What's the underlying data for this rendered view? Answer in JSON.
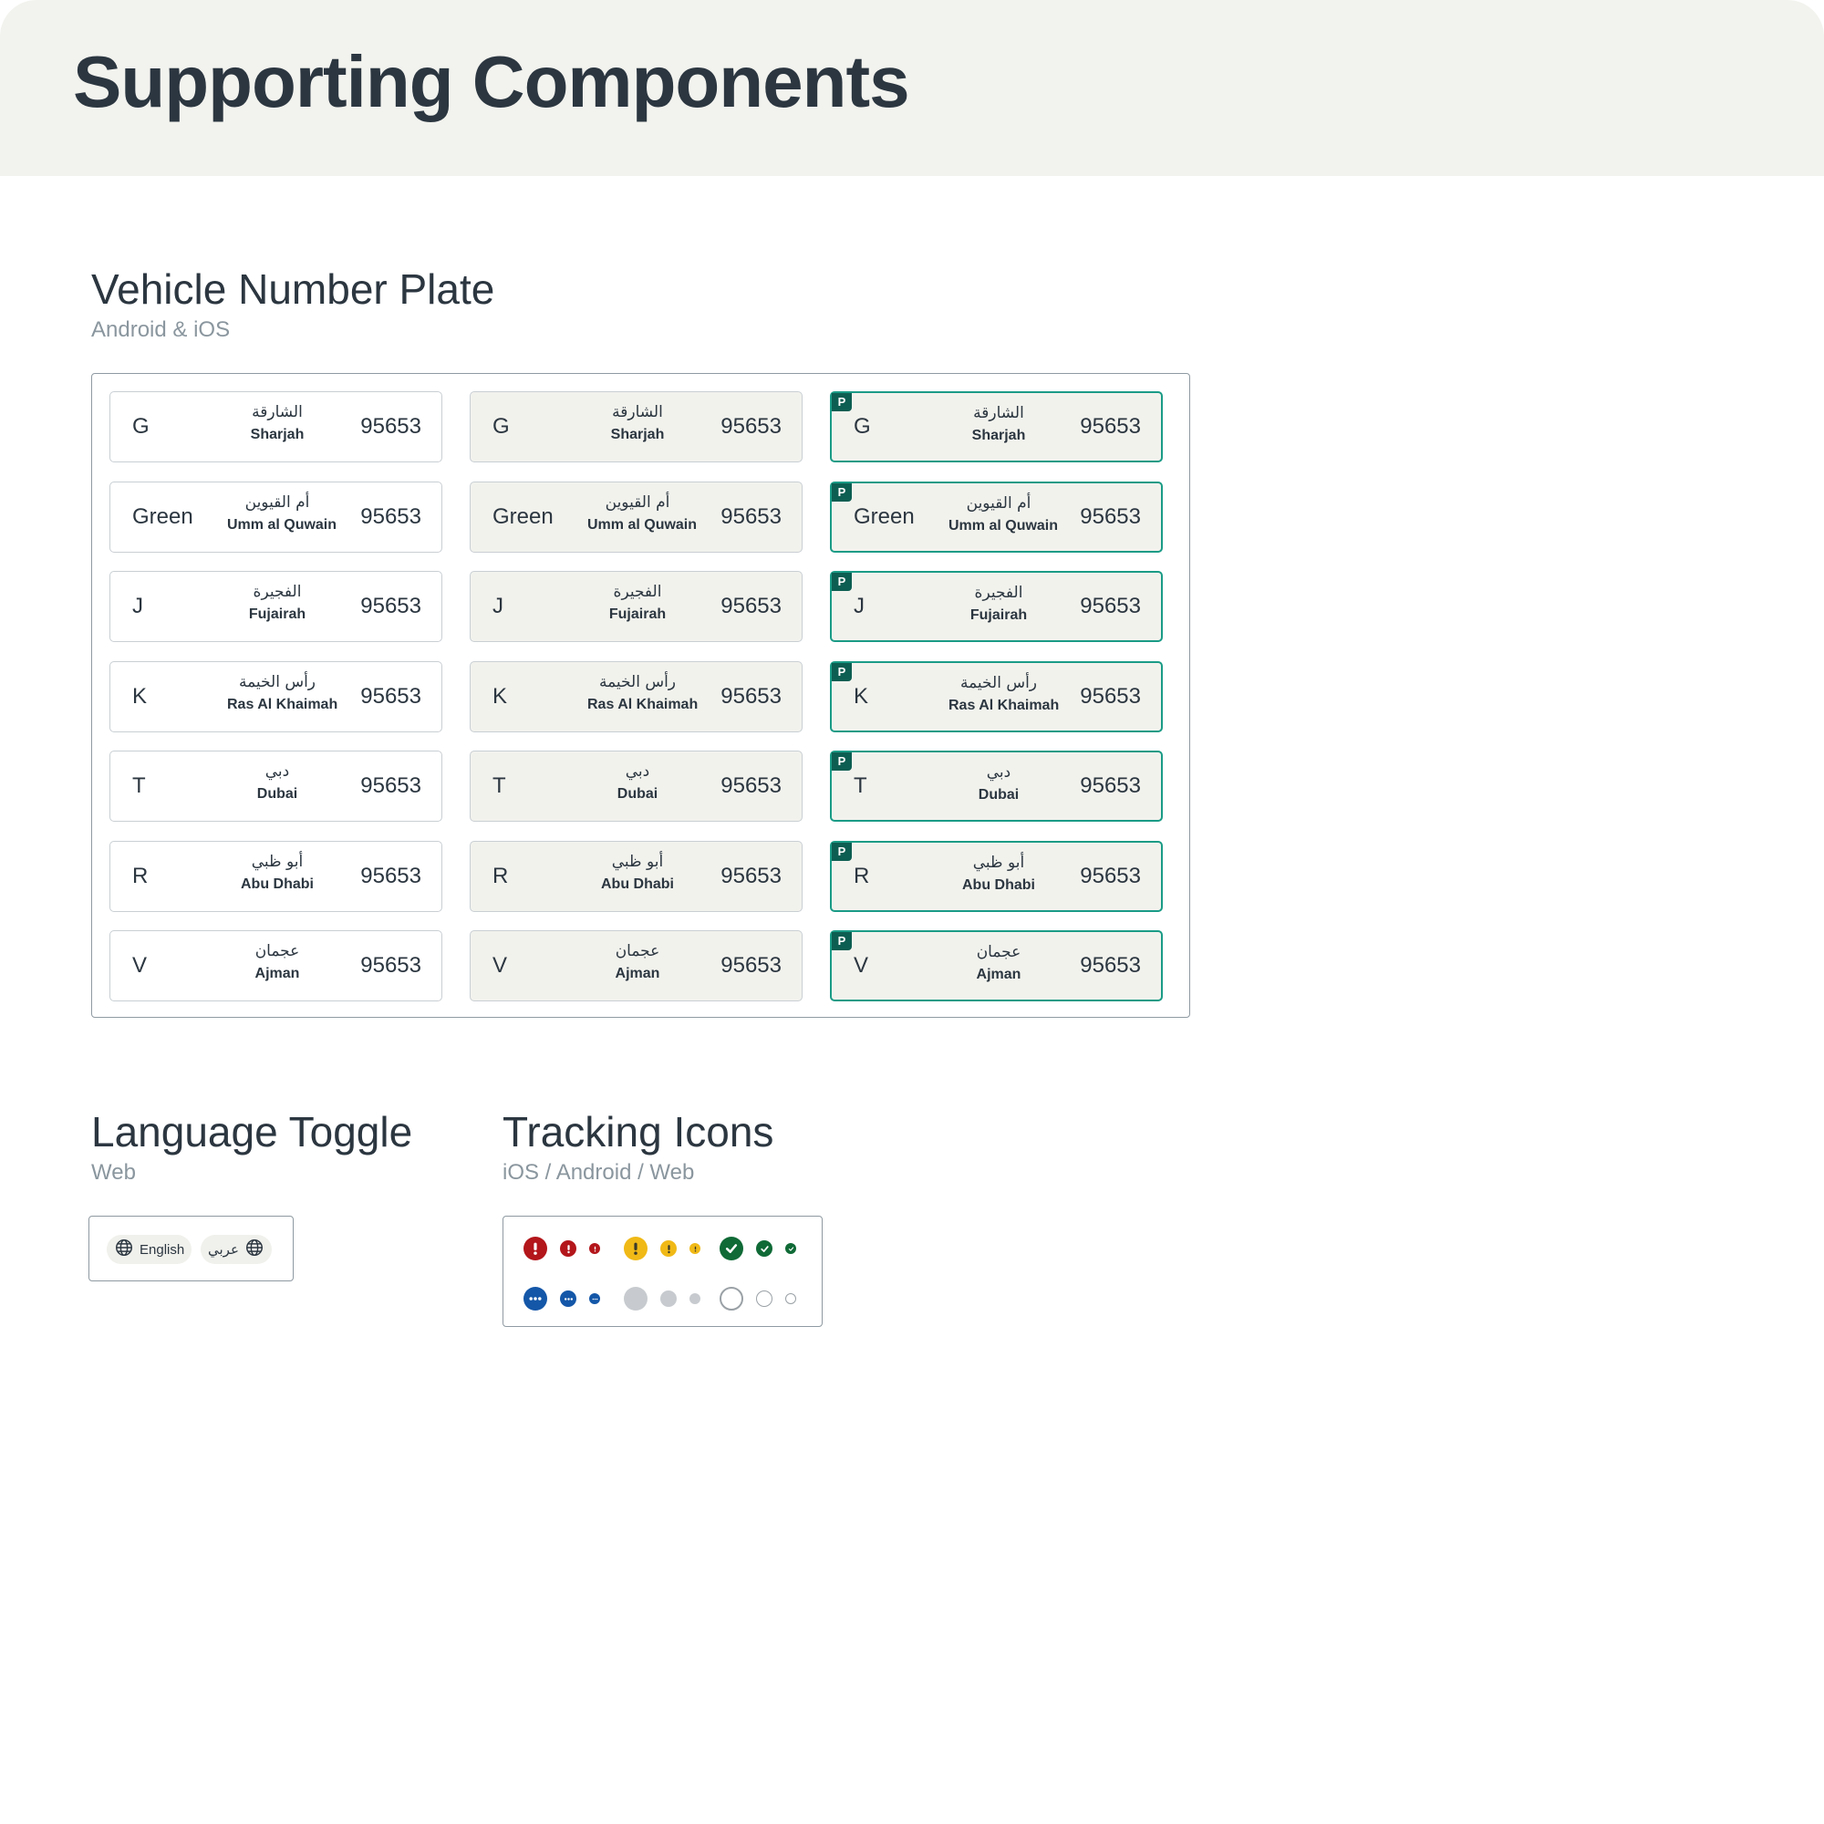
{
  "page": {
    "title": "Supporting Components"
  },
  "vehicle_plate": {
    "title": "Vehicle Number Plate",
    "subtitle": "Android & iOS",
    "plates": [
      {
        "code": "G",
        "arabic": "الشارقة",
        "english": "Sharjah",
        "number": "95653"
      },
      {
        "code": "Green",
        "arabic": "أم القيوين",
        "english": "Umm al Quwain",
        "number": "95653"
      },
      {
        "code": "J",
        "arabic": "الفجيرة",
        "english": "Fujairah",
        "number": "95653"
      },
      {
        "code": "K",
        "arabic": "رأس الخيمة",
        "english": "Ras Al Khaimah",
        "number": "95653"
      },
      {
        "code": "T",
        "arabic": "دبي",
        "english": "Dubai",
        "number": "95653"
      },
      {
        "code": "R",
        "arabic": "أبو ظبي",
        "english": "Abu Dhabi",
        "number": "95653"
      },
      {
        "code": "V",
        "arabic": "عجمان",
        "english": "Ajman",
        "number": "95653"
      }
    ],
    "premium_badge": "P",
    "colors": {
      "premium_border": "#1a9b86",
      "premium_badge": "#0d5e52",
      "filled_bg": "#f2f2ed"
    }
  },
  "language_toggle": {
    "title": "Language Toggle",
    "subtitle": "Web",
    "english_label": "English",
    "arabic_label": "عربي",
    "icon": "globe-icon"
  },
  "tracking_icons": {
    "title": "Tracking Icons",
    "subtitle": "iOS / Android / Web",
    "rows": [
      [
        {
          "type": "error",
          "icon": "exclamation-icon",
          "color": "#b3161b"
        },
        {
          "type": "warning",
          "icon": "exclamation-icon",
          "color": "#f0b916"
        },
        {
          "type": "success",
          "icon": "check-icon",
          "color": "#0f6a36"
        }
      ],
      [
        {
          "type": "in-progress",
          "icon": "ellipsis-icon",
          "color": "#1457a8"
        },
        {
          "type": "pending",
          "icon": "filled-circle-icon",
          "color": "#c7cbcf"
        },
        {
          "type": "not-started",
          "icon": "empty-circle-icon",
          "color": "#9aa1a6"
        }
      ]
    ]
  }
}
